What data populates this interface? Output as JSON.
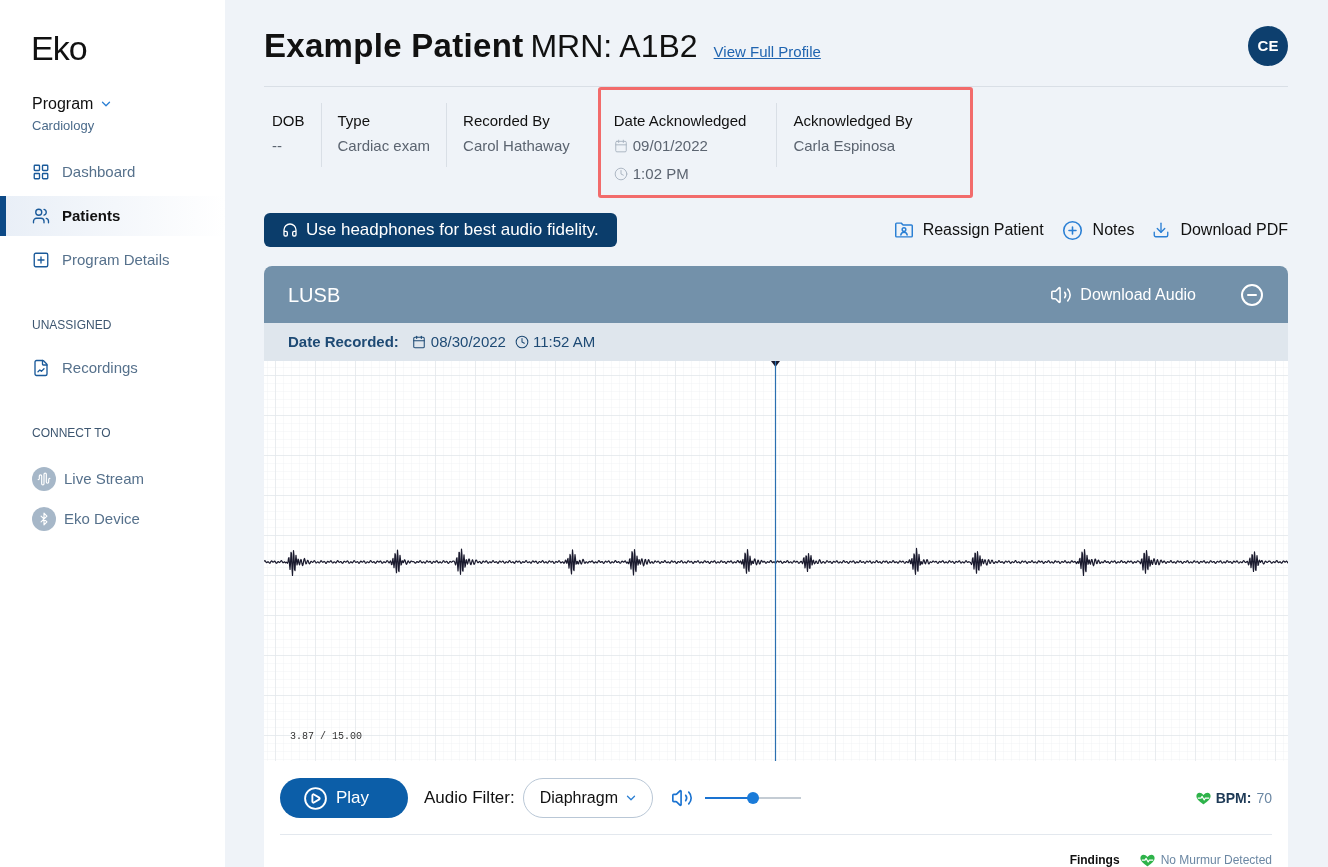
{
  "sidebar": {
    "logo": "Eko",
    "program": {
      "label": "Program",
      "value": "Cardiology"
    },
    "groups": [
      {
        "items": [
          {
            "label": "Dashboard",
            "kind": "page",
            "selected": false
          },
          {
            "label": "Patients",
            "kind": "page",
            "selected": true
          },
          {
            "label": "Program Details",
            "kind": "page",
            "selected": false
          }
        ]
      },
      {
        "heading": "UNASSIGNED",
        "items": [
          {
            "label": "Recordings",
            "kind": "page",
            "selected": false
          }
        ]
      },
      {
        "heading": "CONNECT TO",
        "items": [
          {
            "label": "Live Stream",
            "kind": "connection",
            "selected": false
          },
          {
            "label": "Eko Device",
            "kind": "connection",
            "selected": false
          }
        ]
      }
    ]
  },
  "patient": {
    "name": "Example Patient",
    "mrn": "MRN: A1B2",
    "profile_link": "View Full Profile"
  },
  "user": {
    "initials": "CE"
  },
  "details": [
    {
      "kind": "text",
      "label": "DOB",
      "value": "--",
      "highlighted": false
    },
    {
      "kind": "text",
      "label": "Type",
      "value": "Cardiac exam",
      "highlighted": false
    },
    {
      "kind": "text",
      "label": "Recorded By",
      "value": "Carol Hathaway",
      "highlighted": false
    },
    {
      "kind": "datetime",
      "label": "Date Acknowledged",
      "date": "09/01/2022",
      "time": "1:02 PM",
      "highlighted": true
    },
    {
      "kind": "text",
      "label": "Acknowledged By",
      "value": "Carla Espinosa",
      "highlighted": true
    }
  ],
  "notice": "Use headphones for best audio fidelity.",
  "actions": [
    "Reassign Patient",
    "Notes",
    "Download PDF"
  ],
  "recording": {
    "site": "LUSB",
    "download_audio": "Download Audio",
    "date_label": "Date Recorded:",
    "date": "08/30/2022",
    "time": "11:52 AM",
    "position": "3.87 / 15.00"
  },
  "player": {
    "play": "Play",
    "filter_label": "Audio Filter:",
    "filter": "Diaphragm",
    "volume": {
      "level": 0.5
    },
    "bpm_label": "BPM:",
    "bpm": "70"
  },
  "findings": {
    "label": "Findings",
    "value": "No Murmur Detected"
  }
}
